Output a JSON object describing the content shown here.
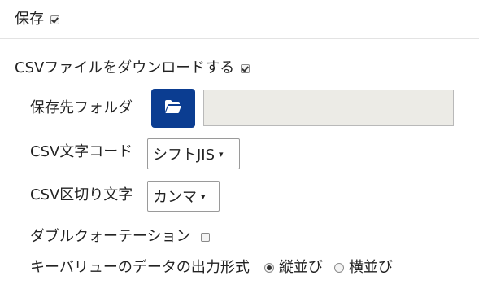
{
  "save": {
    "label": "保存",
    "checked": true
  },
  "csv_download": {
    "label": "CSVファイルをダウンロードする",
    "checked": true
  },
  "save_folder": {
    "label": "保存先フォルダ",
    "button_icon": "folder-open-icon",
    "button_color": "#0b3d91",
    "value": ""
  },
  "csv_encoding": {
    "label": "CSV文字コード",
    "selected": "シフトJIS",
    "arrow": "▾"
  },
  "csv_delimiter": {
    "label": "CSV区切り文字",
    "selected": "カンマ",
    "arrow": "▾"
  },
  "double_quote": {
    "label": "ダブルクォーテーション",
    "checked": false
  },
  "key_value_output": {
    "label": "キーバリューのデータの出力形式",
    "options": [
      {
        "label": "縦並び",
        "selected": true
      },
      {
        "label": "横並び",
        "selected": false
      }
    ]
  }
}
